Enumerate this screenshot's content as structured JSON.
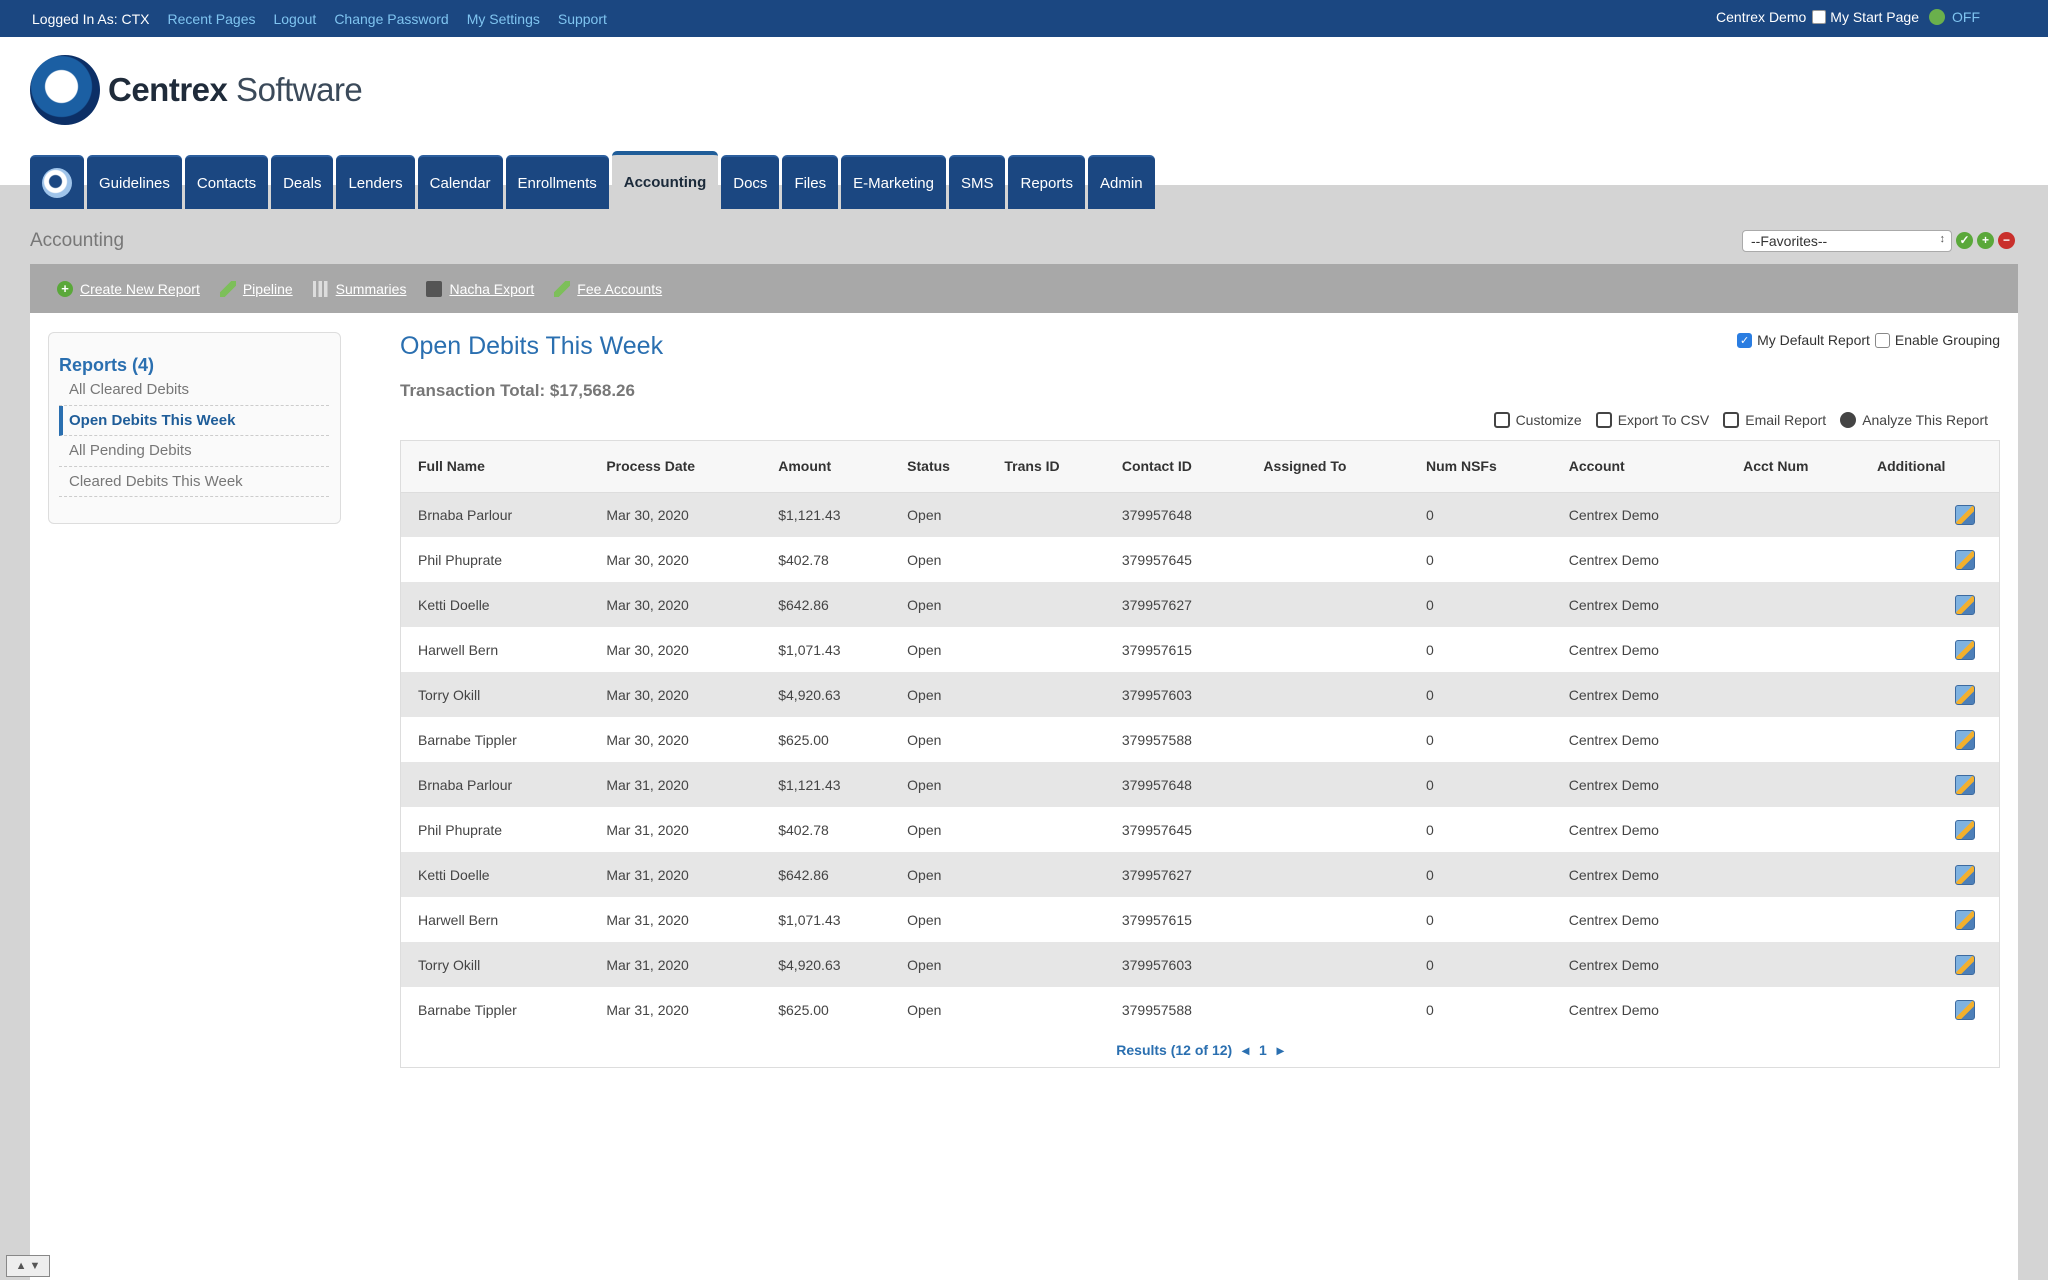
{
  "topbar": {
    "logged_in": "Logged In As: CTX",
    "links": [
      "Recent Pages",
      "Logout",
      "Change Password",
      "My Settings",
      "Support"
    ],
    "account": "Centrex Demo",
    "start_page": "My Start Page",
    "toggle_state": "OFF"
  },
  "brand": {
    "name_bold": "Centrex",
    "name_light": " Software"
  },
  "tabs": [
    "Guidelines",
    "Contacts",
    "Deals",
    "Lenders",
    "Calendar",
    "Enrollments",
    "Accounting",
    "Docs",
    "Files",
    "E-Marketing",
    "SMS",
    "Reports",
    "Admin"
  ],
  "page": {
    "title": "Accounting",
    "favorites": "--Favorites--"
  },
  "subnav": [
    "Create New Report",
    "Pipeline",
    "Summaries",
    "Nacha Export",
    "Fee Accounts"
  ],
  "sidebar": {
    "title": "Reports (4)",
    "items": [
      "All Cleared Debits",
      "Open Debits This Week",
      "All Pending Debits",
      "Cleared Debits This Week"
    ]
  },
  "report": {
    "title": "Open Debits This Week",
    "total": "Transaction Total: $17,568.26",
    "my_default": "My Default Report",
    "enable_grouping": "Enable Grouping",
    "actions": [
      "Customize",
      "Export To CSV",
      "Email Report",
      "Analyze This Report"
    ],
    "columns": [
      "Full Name",
      "Process Date",
      "Amount",
      "Status",
      "Trans ID",
      "Contact ID",
      "Assigned To",
      "Num NSFs",
      "Account",
      "Acct Num",
      "Additional"
    ],
    "rows": [
      [
        "Brnaba Parlour",
        "Mar 30, 2020",
        "$1,121.43",
        "Open",
        "",
        "379957648",
        "",
        "0",
        "Centrex Demo",
        "",
        ""
      ],
      [
        "Phil Phuprate",
        "Mar 30, 2020",
        "$402.78",
        "Open",
        "",
        "379957645",
        "",
        "0",
        "Centrex Demo",
        "",
        ""
      ],
      [
        "Ketti Doelle",
        "Mar 30, 2020",
        "$642.86",
        "Open",
        "",
        "379957627",
        "",
        "0",
        "Centrex Demo",
        "",
        ""
      ],
      [
        "Harwell Bern",
        "Mar 30, 2020",
        "$1,071.43",
        "Open",
        "",
        "379957615",
        "",
        "0",
        "Centrex Demo",
        "",
        ""
      ],
      [
        "Torry Okill",
        "Mar 30, 2020",
        "$4,920.63",
        "Open",
        "",
        "379957603",
        "",
        "0",
        "Centrex Demo",
        "",
        ""
      ],
      [
        "Barnabe Tippler",
        "Mar 30, 2020",
        "$625.00",
        "Open",
        "",
        "379957588",
        "",
        "0",
        "Centrex Demo",
        "",
        ""
      ],
      [
        "Brnaba Parlour",
        "Mar 31, 2020",
        "$1,121.43",
        "Open",
        "",
        "379957648",
        "",
        "0",
        "Centrex Demo",
        "",
        ""
      ],
      [
        "Phil Phuprate",
        "Mar 31, 2020",
        "$402.78",
        "Open",
        "",
        "379957645",
        "",
        "0",
        "Centrex Demo",
        "",
        ""
      ],
      [
        "Ketti Doelle",
        "Mar 31, 2020",
        "$642.86",
        "Open",
        "",
        "379957627",
        "",
        "0",
        "Centrex Demo",
        "",
        ""
      ],
      [
        "Harwell Bern",
        "Mar 31, 2020",
        "$1,071.43",
        "Open",
        "",
        "379957615",
        "",
        "0",
        "Centrex Demo",
        "",
        ""
      ],
      [
        "Torry Okill",
        "Mar 31, 2020",
        "$4,920.63",
        "Open",
        "",
        "379957603",
        "",
        "0",
        "Centrex Demo",
        "",
        ""
      ],
      [
        "Barnabe Tippler",
        "Mar 31, 2020",
        "$625.00",
        "Open",
        "",
        "379957588",
        "",
        "0",
        "Centrex Demo",
        "",
        ""
      ]
    ],
    "pager": {
      "results": "Results (12 of 12)",
      "page": "1"
    }
  }
}
